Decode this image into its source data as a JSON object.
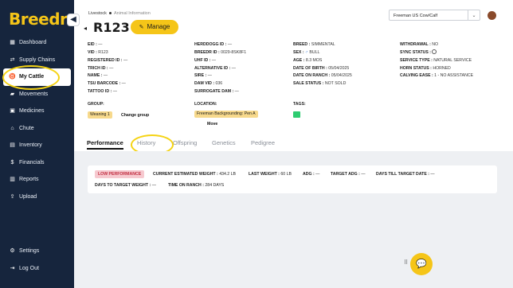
{
  "app": {
    "logo_text": "Breedr",
    "brand_color": "#f5c518",
    "sidebar_color": "#16253d"
  },
  "sidebar": {
    "items": [
      {
        "label": "Dashboard",
        "icon": "dashboard-icon"
      },
      {
        "label": "Supply Chains",
        "icon": "supply-chain-icon"
      },
      {
        "label": "My Cattle",
        "icon": "cattle-icon",
        "active": true
      },
      {
        "label": "Movements",
        "icon": "truck-icon"
      },
      {
        "label": "Medicines",
        "icon": "medicine-icon"
      },
      {
        "label": "Chute",
        "icon": "chute-icon"
      },
      {
        "label": "Inventory",
        "icon": "inventory-icon"
      },
      {
        "label": "Financials",
        "icon": "dollar-icon"
      },
      {
        "label": "Reports",
        "icon": "reports-icon"
      },
      {
        "label": "Upload",
        "icon": "upload-icon"
      }
    ],
    "bottom": [
      {
        "label": "Settings",
        "icon": "gear-icon"
      },
      {
        "label": "Log Out",
        "icon": "logout-icon"
      }
    ]
  },
  "header": {
    "breadcrumb": [
      "Livestock",
      "Animal Information"
    ],
    "ranch_select": "Freeman US Cow/Calf",
    "animal_id": "R123",
    "manage_label": "Manage"
  },
  "info": {
    "col1": [
      {
        "label": "EID :",
        "value": "—"
      },
      {
        "label": "VID :",
        "value": "R123"
      },
      {
        "label": "REGISTERED ID :",
        "value": "—"
      },
      {
        "label": "TRICH ID :",
        "value": "—"
      },
      {
        "label": "NAME :",
        "value": "—"
      },
      {
        "label": "TSU BARCODE :",
        "value": "—"
      },
      {
        "label": "TATTOO ID :",
        "value": "—"
      }
    ],
    "col2": [
      {
        "label": "HERDDOGG ID :",
        "value": "—"
      },
      {
        "label": "BREEDR ID :",
        "value": "0029-8SK8F1"
      },
      {
        "label": "UHF ID :",
        "value": "—"
      },
      {
        "label": "ALTERNATIVE ID :",
        "value": "—"
      },
      {
        "label": "SIRE :",
        "value": "—"
      },
      {
        "label": "DAM VID :",
        "value": "036"
      },
      {
        "label": "SURROGATE DAM :",
        "value": "—"
      }
    ],
    "col3": [
      {
        "label": "BREED :",
        "value": "SIMMENTAL"
      },
      {
        "label": "SEX :",
        "value": "BULL",
        "icon": "male-icon"
      },
      {
        "label": "AGE :",
        "value": "8.3 MOS"
      },
      {
        "label": "DATE OF BIRTH :",
        "value": "05/04/2025"
      },
      {
        "label": "DATE ON RANCH :",
        "value": "05/04/2025"
      },
      {
        "label": "SALE STATUS :",
        "value": "NOT SOLD"
      }
    ],
    "col4": [
      {
        "label": "WITHDRAWAL :",
        "value": "NO"
      },
      {
        "label": "SYNC STATUS :",
        "value": "",
        "icon": "clock-icon"
      },
      {
        "label": "SERVICE TYPE :",
        "value": "NATURAL SERVICE"
      },
      {
        "label": "HORN STATUS :",
        "value": "HORNED"
      },
      {
        "label": "CALVING EASE :",
        "value": "1 - NO ASSISTANCE"
      }
    ]
  },
  "group": {
    "label": "GROUP:",
    "value": "Weaning 1",
    "change_label": "Change group"
  },
  "location": {
    "label": "LOCATION:",
    "value": "Freeman Backgrounding: Pen A",
    "move_label": "Move"
  },
  "tags": {
    "label": "TAGS:",
    "color": "#2ecc71"
  },
  "tabs": [
    "Performance",
    "History",
    "Offspring",
    "Genetics",
    "Pedigree"
  ],
  "performance": {
    "badge": "LOW PERFORMANCE",
    "stats": [
      {
        "label": "CURRENT ESTIMATED WEIGHT :",
        "value": "434.2 LB"
      },
      {
        "label": "LAST WEIGHT :",
        "value": "60 LB"
      },
      {
        "label": "ADG :",
        "value": "—"
      },
      {
        "label": "TARGET ADG :",
        "value": "—"
      },
      {
        "label": "DAYS TILL TARGET DATE :",
        "value": "—"
      },
      {
        "label": "DAYS TO TARGET WEIGHT :",
        "value": "—"
      },
      {
        "label": "TIME ON RANCH :",
        "value": "284 DAYS"
      }
    ]
  }
}
